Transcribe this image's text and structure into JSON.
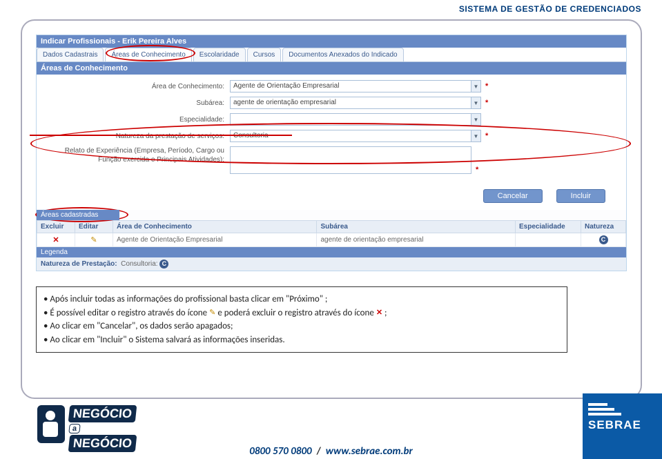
{
  "header": {
    "title": "SISTEMA DE GESTÃO DE CREDENCIADOS"
  },
  "panel": {
    "title": "Indicar Profissionais - Erik Pereira Alves"
  },
  "tabs": [
    {
      "label": "Dados Cadastrais"
    },
    {
      "label": "Áreas de Conhecimento"
    },
    {
      "label": "Escolaridade"
    },
    {
      "label": "Cursos"
    },
    {
      "label": "Documentos Anexados do Indicado"
    }
  ],
  "section": {
    "title": "Áreas de Conhecimento"
  },
  "form": {
    "area_label": "Área de Conhecimento:",
    "area_value": "Agente de Orientação Empresarial",
    "subarea_label": "Subárea:",
    "subarea_value": "agente de orientação empresarial",
    "espec_label": "Especialidade:",
    "espec_value": "",
    "natureza_label": "Natureza da prestação de serviços:",
    "natureza_value": "Consultoria",
    "relato_label": "Relato de Experiência (Empresa, Período, Cargo ou Função exercida e Principais Atividades):"
  },
  "buttons": {
    "cancel": "Cancelar",
    "include": "Incluir"
  },
  "areas_cad": {
    "title": "Áreas cadastradas"
  },
  "table": {
    "headers": {
      "excluir": "Excluir",
      "editar": "Editar",
      "area": "Área de Conhecimento",
      "subarea": "Subárea",
      "espec": "Especialidade",
      "nat": "Natureza"
    },
    "row": {
      "area": "Agente de Orientação Empresarial",
      "subarea": "agente de orientação empresarial",
      "espec": "",
      "nat": "C"
    }
  },
  "legend": {
    "title": "Legenda",
    "label": "Natureza de Prestação:",
    "value": "Consultoria:",
    "badge": "C"
  },
  "instructions": {
    "line1_a": "• Após incluir todas as informações do profissional basta clicar  em \"Próximo\" ;",
    "line2_a": "• É possível editar o registro através do ícone",
    "line2_b": "e poderá excluir o registro através do ícone",
    "line2_c": ";",
    "line3": "• Ao clicar em \"Cancelar\", os dados serão apagados;",
    "line4": "• Ao clicar em \"Incluir\" o Sistema salvará as informações inseridas."
  },
  "logo": {
    "t1": "NEGÓCIO",
    "t2": "a",
    "t3": "NEGÓCIO"
  },
  "sebrae": {
    "text": "SEBRAE"
  },
  "footer": {
    "phone": "0800 570 0800",
    "sep": "/",
    "url": "www.sebrae.com.br"
  }
}
